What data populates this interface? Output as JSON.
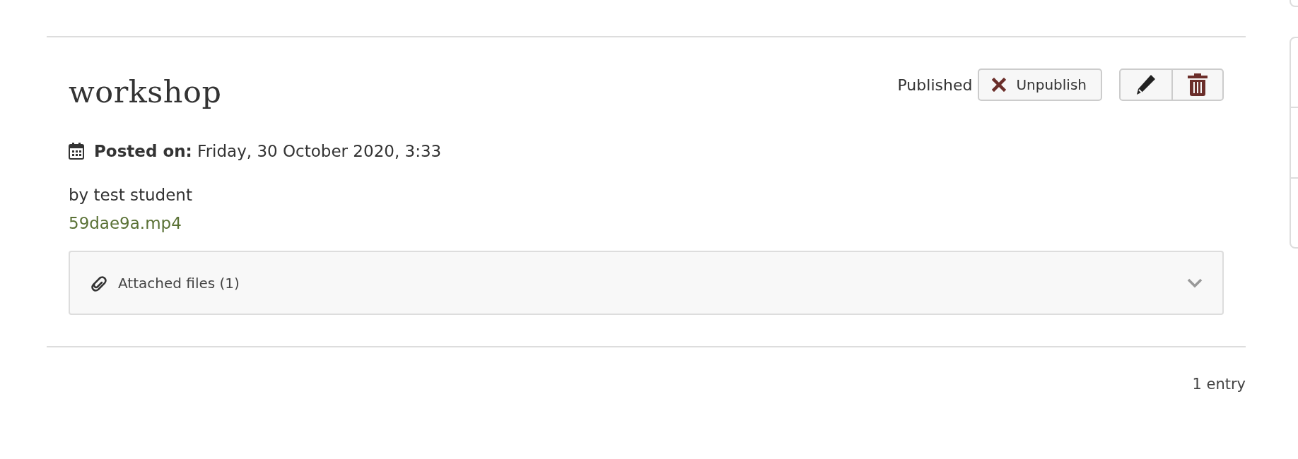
{
  "entry": {
    "title": "workshop",
    "status": "Published",
    "unpublish_button": "Unpublish",
    "posted_label": "Posted on:",
    "posted_date": "Friday, 30 October 2020, 3:33",
    "author": "by test student",
    "attachment_link": "59dae9a.mp4",
    "attached_files": {
      "label": "Attached files (1)",
      "expanded": false
    }
  },
  "footer": {
    "count": "1 entry"
  }
}
